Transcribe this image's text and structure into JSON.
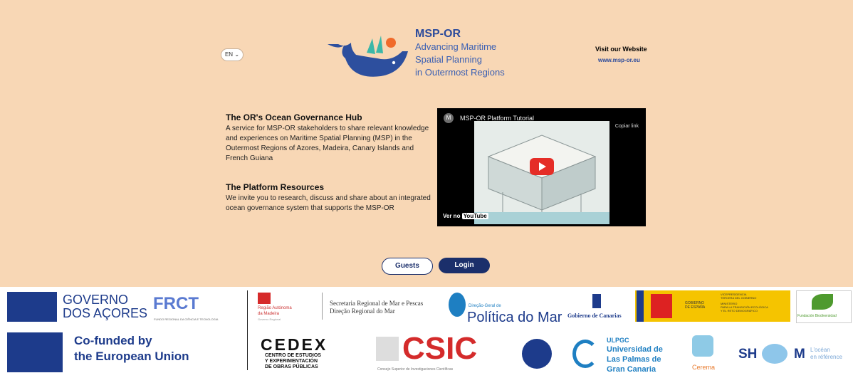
{
  "language": "EN",
  "brand": {
    "title": "MSP-OR",
    "line1": "Advancing Maritime",
    "line2": "Spatial Planning",
    "line3": "in Outermost Regions"
  },
  "website": {
    "label": "Visit our Website",
    "url": "www.msp-or.eu"
  },
  "hub": {
    "title": "The OR's Ocean Governance Hub",
    "text": "A service for MSP-OR stakeholders to share relevant knowledge and experiences on Maritime Spatial Planning (MSP) in the Outermost Regions of Azores, Madeira, Canary Islands and French Guiana"
  },
  "resources": {
    "title": "The Platform Resources",
    "text": "We invite you to research, discuss and share about an integrated ocean governance system that supports the MSP-OR"
  },
  "video": {
    "title": "MSP-OR Platform Tutorial",
    "avatar": "M",
    "copy": "Copiar link",
    "watch": "Ver no",
    "platform": "YouTube"
  },
  "buttons": {
    "guests": "Guests",
    "login": "Login"
  },
  "footer": {
    "azores1": "GOVERNO",
    "azores2": "DOS AÇORES",
    "frct": "FRCT",
    "frct_sub": "FUNDO REGIONAL DA CIÊNCIA E TECNOLOGIA",
    "madeira1": "Região Autónoma",
    "madeira2": "da Madeira",
    "madeira3": "Governo Regional",
    "sec1": "Secretaria Regional de Mar e Pescas",
    "sec2": "Direção Regional do Mar",
    "dgpm_small": "Direção-Geral de",
    "dgpm": "Política do Mar",
    "canarias": "Gobierno de Canarias",
    "espana1": "GOBIERNO",
    "espana2": "DE ESPAÑA",
    "vice1": "VICEPRESIDENCIA",
    "vice2": "TERCERA DEL GOBIERNO",
    "vice3": "MINISTERIO",
    "vice4": "PARA LA TRANSICIÓN ECOLÓGICA",
    "vice5": "Y EL RETO DEMOGRÁFICO",
    "biodiv": "Fundación Biodiversidad",
    "eu1": "Co-funded by",
    "eu2": "the European Union",
    "cedex": "CEDEX",
    "cedex2": "CENTRO DE ESTUDIOS",
    "cedex3": "Y EXPERIMENTACIÓN",
    "cedex4": "DE OBRAS PÚBLICAS",
    "csic": "CSIC",
    "csic_sub": "Consejo Superior de Investigaciones Científicas",
    "ulpgc1": "ULPGC",
    "ulpgc2": "Universidad de",
    "ulpgc3": "Las Palmas de",
    "ulpgc4": "Gran Canaria",
    "cerema": "Cerema",
    "shom": "SH",
    "shom2": "M",
    "ocean1": "L'océan",
    "ocean2": "en référence"
  }
}
